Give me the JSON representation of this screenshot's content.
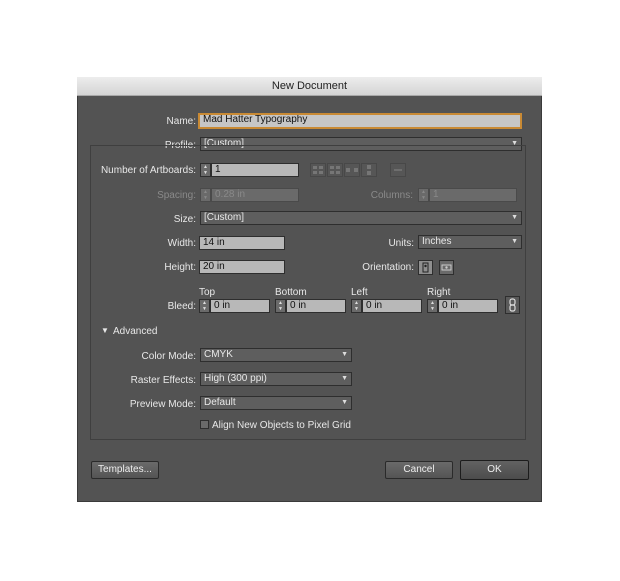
{
  "window": {
    "title": "New Document"
  },
  "form": {
    "name_label": "Name:",
    "name_value": "Mad Hatter Typography",
    "profile_label": "Profile:",
    "profile_value": "[Custom]",
    "artboards_label": "Number of Artboards:",
    "artboards_value": "1",
    "spacing_label": "Spacing:",
    "spacing_value": "0.28 in",
    "columns_label": "Columns:",
    "columns_value": "1",
    "size_label": "Size:",
    "size_value": "[Custom]",
    "width_label": "Width:",
    "width_value": "14 in",
    "units_label": "Units:",
    "units_value": "Inches",
    "height_label": "Height:",
    "height_value": "20 in",
    "orientation_label": "Orientation:",
    "bleed_label": "Bleed:",
    "bleed_top_label": "Top",
    "bleed_top_value": "0 in",
    "bleed_bottom_label": "Bottom",
    "bleed_bottom_value": "0 in",
    "bleed_left_label": "Left",
    "bleed_left_value": "0 in",
    "bleed_right_label": "Right",
    "bleed_right_value": "0 in"
  },
  "advanced": {
    "toggle_label": "Advanced",
    "color_mode_label": "Color Mode:",
    "color_mode_value": "CMYK",
    "raster_label": "Raster Effects:",
    "raster_value": "High (300 ppi)",
    "preview_label": "Preview Mode:",
    "preview_value": "Default",
    "align_label": "Align New Objects to Pixel Grid"
  },
  "buttons": {
    "templates": "Templates...",
    "cancel": "Cancel",
    "ok": "OK"
  },
  "colors": {
    "dialog_bg": "#535353",
    "focus_ring": "#c98a34",
    "field_bg": "#b8b8b8"
  },
  "icons": [
    "arrange-grid-by-row-icon",
    "arrange-grid-by-column-icon",
    "arrange-by-row-icon",
    "arrange-by-column-icon",
    "change-to-rtl-icon",
    "portrait-orientation-icon",
    "landscape-orientation-icon",
    "link-bleed-icon",
    "disclosure-triangle-icon"
  ]
}
